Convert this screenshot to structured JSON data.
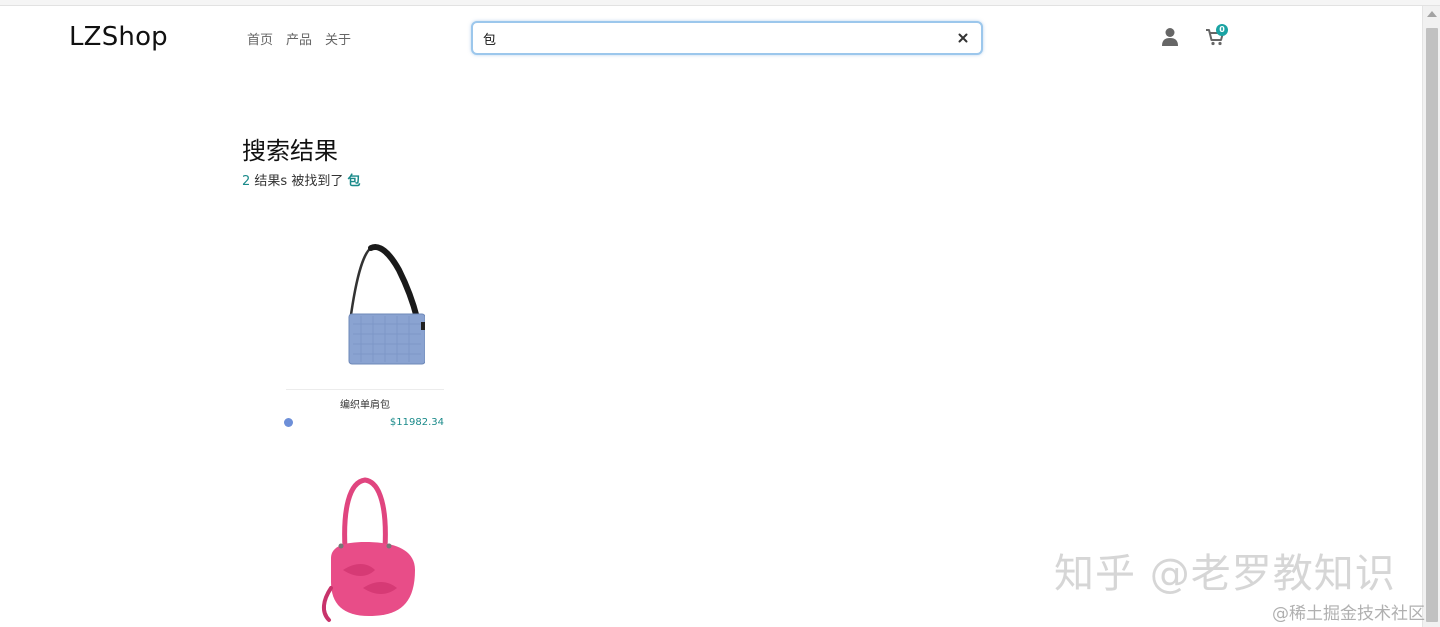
{
  "header": {
    "logo": "LZShop",
    "nav": [
      "首页",
      "产品",
      "关于"
    ],
    "search": {
      "value": "包",
      "placeholder": ""
    },
    "cart_count": "0"
  },
  "results": {
    "title": "搜索结果",
    "count": "2",
    "found_text": " 结果s 被找到了 ",
    "query": "包"
  },
  "products": [
    {
      "name": "编织单肩包",
      "price": "$11982.34",
      "swatch_color": "#6d8fd8"
    },
    {
      "name": "",
      "price": ""
    }
  ],
  "icons": [
    "close-icon",
    "user-icon",
    "cart-icon"
  ],
  "colors": {
    "accent": "#1aa3a3",
    "price": "#1a8a8a",
    "search_border": "#9cc7ec"
  },
  "watermark": {
    "main": "知乎 @老罗教知识",
    "sub": "@稀土掘金技术社区"
  }
}
